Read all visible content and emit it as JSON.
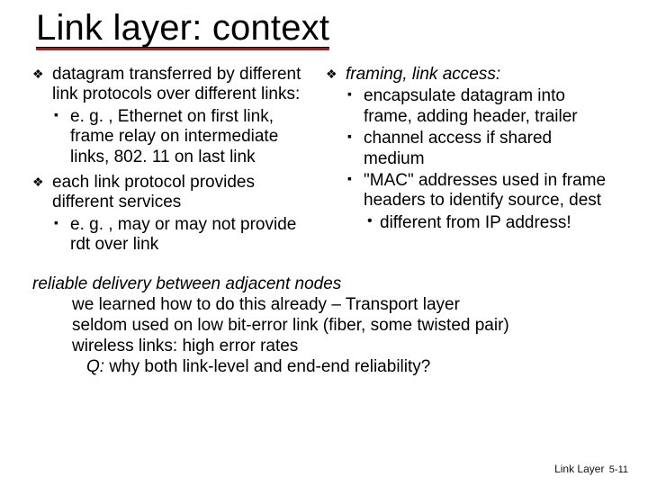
{
  "title": "Link layer: context",
  "left": {
    "items": [
      {
        "text": "datagram transferred by different link protocols over different links:",
        "sub": [
          "e. g. , Ethernet on first link, frame relay on intermediate links, 802. 11 on last link"
        ]
      },
      {
        "text": "each  link protocol provides different services",
        "sub": [
          "e. g. , may or may not provide rdt over link"
        ]
      }
    ]
  },
  "right": {
    "head": "framing, link access:",
    "sub": [
      "encapsulate datagram into frame, adding header, trailer",
      "channel access if shared medium",
      "\"MAC\" addresses used in frame headers to identify source, dest"
    ],
    "sub3": "different from IP address!"
  },
  "bottom": {
    "l1": "reliable delivery between adjacent nodes",
    "l2": "we learned how to do this already – Transport layer",
    "l3": "seldom used on low bit-error link (fiber, some twisted pair)",
    "l4": "wireless links: high error rates",
    "q_label": "Q:",
    "q_text": " why both link-level and end-end reliability?"
  },
  "footer": {
    "section": "Link Layer",
    "page": "5-11"
  }
}
